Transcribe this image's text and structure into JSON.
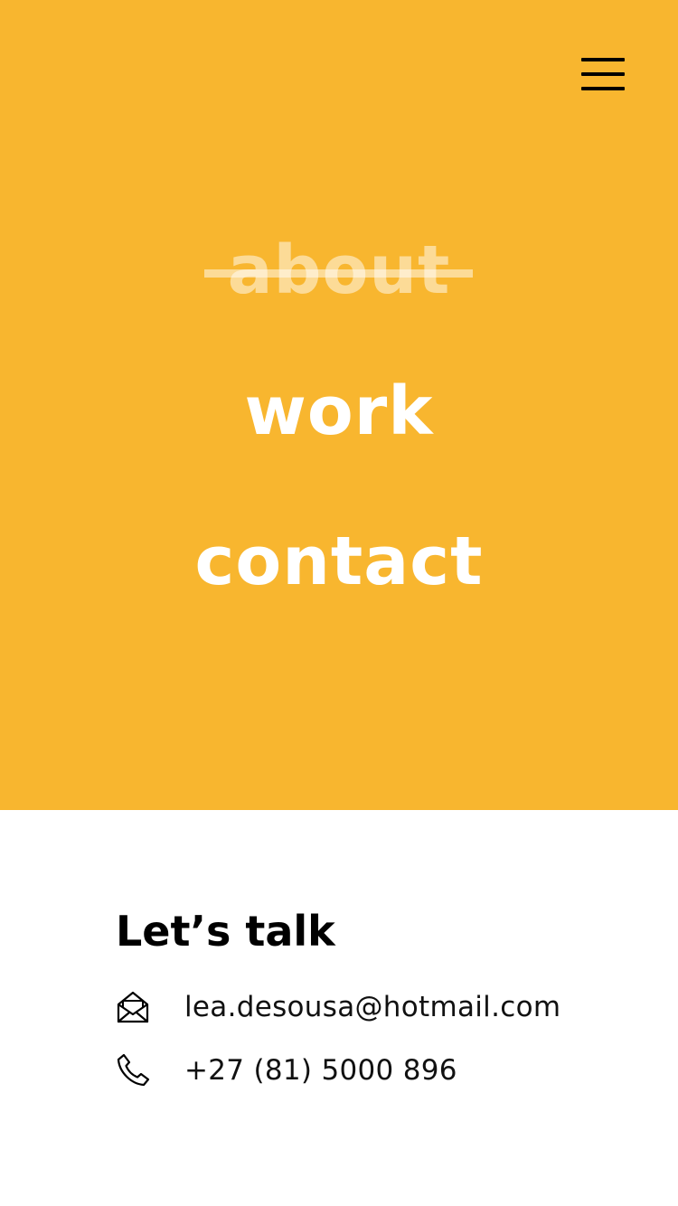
{
  "colors": {
    "accent": "#F8B62F",
    "nav_text": "#FFFFFF",
    "nav_inactive": "rgba(255,255,255,0.5)",
    "body_text": "#000000"
  },
  "header": {
    "menu_icon": "hamburger-menu-icon"
  },
  "nav": {
    "items": [
      {
        "label": "about",
        "state": "struck-through"
      },
      {
        "label": "work",
        "state": "normal"
      },
      {
        "label": "contact",
        "state": "normal"
      }
    ]
  },
  "contact": {
    "title": "Let’s talk",
    "email": {
      "icon": "envelope-icon",
      "value": "lea.desousa@hotmail.com"
    },
    "phone": {
      "icon": "phone-icon",
      "value": "+27 (81) 5000 896"
    }
  }
}
